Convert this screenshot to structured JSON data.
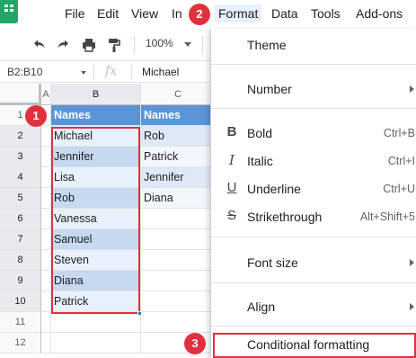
{
  "menubar": {
    "items": [
      "File",
      "Edit",
      "View",
      "In",
      "Format",
      "Data",
      "Tools",
      "Add-ons"
    ]
  },
  "toolbar": {
    "zoom": "100%",
    "icons": [
      "undo-icon",
      "redo-icon",
      "print-icon",
      "paint-format-icon"
    ]
  },
  "formula_bar": {
    "name_box": "B2:B10",
    "fx": "fx",
    "value": "Michael"
  },
  "grid": {
    "columns": [
      "A",
      "B",
      "C"
    ],
    "rows": [
      "1",
      "2",
      "3",
      "4",
      "5",
      "6",
      "7",
      "8",
      "9",
      "10",
      "11",
      "12"
    ],
    "col_b": [
      "Names",
      "Michael",
      "Jennifer",
      "Lisa",
      "Rob",
      "Vanessa",
      "Samuel",
      "Steven",
      "Diana",
      "Patrick"
    ],
    "col_c": [
      "Names",
      "Rob",
      "Patrick",
      "Jennifer",
      "Diana"
    ]
  },
  "format_menu": {
    "items": [
      {
        "label": "Theme"
      },
      {
        "label": "Number",
        "submenu": true
      },
      {
        "label": "Bold",
        "shortcut": "Ctrl+B",
        "icon": "B"
      },
      {
        "label": "Italic",
        "shortcut": "Ctrl+I",
        "icon": "I"
      },
      {
        "label": "Underline",
        "shortcut": "Ctrl+U",
        "icon": "U"
      },
      {
        "label": "Strikethrough",
        "shortcut": "Alt+Shift+5",
        "icon": "S"
      },
      {
        "label": "Font size",
        "submenu": true
      },
      {
        "label": "Align",
        "submenu": true
      },
      {
        "label": "Conditional formatting"
      }
    ]
  },
  "badges": [
    "1",
    "2",
    "3"
  ],
  "colors": {
    "accent_red": "#e0313f",
    "header_blue": "#5b95d6",
    "band_dark": "#c6d9f0",
    "band_light": "#e8f0fb",
    "sheets_green": "#23a566"
  }
}
